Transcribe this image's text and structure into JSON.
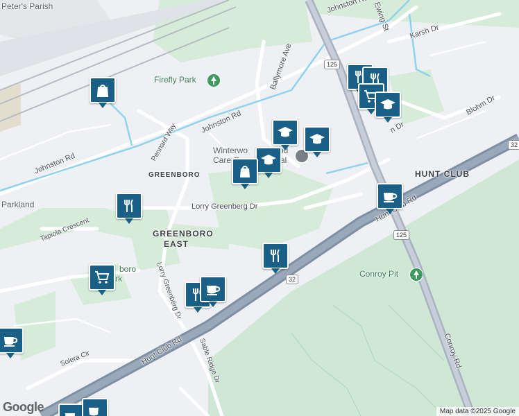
{
  "map": {
    "colors": {
      "background": "#eef0f3",
      "park": "#cfe8d5",
      "water": "#8fd3ec",
      "highway": "#8a99ad",
      "pin": "#1a5f86"
    },
    "labels": {
      "peters_parish": "Peter's Parish",
      "firefly_park": "Firefly Park",
      "johnston_rd_top": "Johnston Rd",
      "ewing_st": "Ewing St",
      "karsh_dr": "Karsh Dr",
      "ballymore_ave": "Ballymore Ave",
      "johnston_rd_mid": "Johnston Rd",
      "pennard_way": "Pennard Way",
      "johnston_rd_left": "Johnston Rd",
      "greenboro": "GREENBORO",
      "winterwood": "Winterwo",
      "winterwood_2": "od",
      "care_centre": "Care C",
      "care_centre_2": "al",
      "hunt_club_area": "HUNT CLUB",
      "blohm_dr": "Blohm Dr",
      "blohm_dr_2": "n Dr",
      "parkland": "Parkland",
      "lorry_greenberg_dr": "Lorry Greenberg Dr",
      "tapiola_crescent": "Tapiola Crescent",
      "greenboro_east": "GREENBORO",
      "greenboro_east_2": "EAST",
      "hunt_club_rd_right": "Hunt Club Rd",
      "conroy_pit": "Conroy Pit",
      "boro_park": "boro",
      "boro_park_2": "rk",
      "lorry_greenberg_dr_2": "Lorry Greenberg Dr",
      "hunt_club_rd_left": "Hunt Club Rd",
      "sable_ridge_dr": "Sable Ridge Dr",
      "conroy_rd": "Conroy Rd",
      "solera_cir": "Solera Cir"
    },
    "shields": {
      "route_125_top": "125",
      "route_125_bottom": "125",
      "route_32_right": "32",
      "route_32_mid": "32"
    },
    "pins": [
      {
        "id": "shopping-1",
        "icon": "shopping-bag-icon"
      },
      {
        "id": "restaurant-1",
        "icon": "fork-knife-icon"
      },
      {
        "id": "restaurant-2",
        "icon": "fork-knife-icon"
      },
      {
        "id": "grocery-1",
        "icon": "shopping-cart-icon"
      },
      {
        "id": "school-1",
        "icon": "graduation-cap-icon"
      },
      {
        "id": "school-2",
        "icon": "graduation-cap-icon"
      },
      {
        "id": "school-3",
        "icon": "graduation-cap-icon"
      },
      {
        "id": "shopping-2",
        "icon": "shopping-bag-icon"
      },
      {
        "id": "restaurant-3",
        "icon": "fork-knife-icon"
      },
      {
        "id": "restaurant-4",
        "icon": "fork-knife-icon"
      },
      {
        "id": "cafe-1",
        "icon": "coffee-cup-icon"
      },
      {
        "id": "grocery-2",
        "icon": "shopping-cart-icon"
      },
      {
        "id": "school-4",
        "icon": "graduation-cap-icon"
      },
      {
        "id": "cafe-2",
        "icon": "coffee-cup-icon"
      },
      {
        "id": "restaurant-5",
        "icon": "fork-knife-icon"
      },
      {
        "id": "cafe-3",
        "icon": "coffee-cup-icon"
      },
      {
        "id": "cafe-4",
        "icon": "coffee-cup-icon"
      },
      {
        "id": "cafe-5",
        "icon": "coffee-cup-icon"
      }
    ],
    "google_logo": "Google",
    "attribution": "Map data ©2025 Google"
  }
}
